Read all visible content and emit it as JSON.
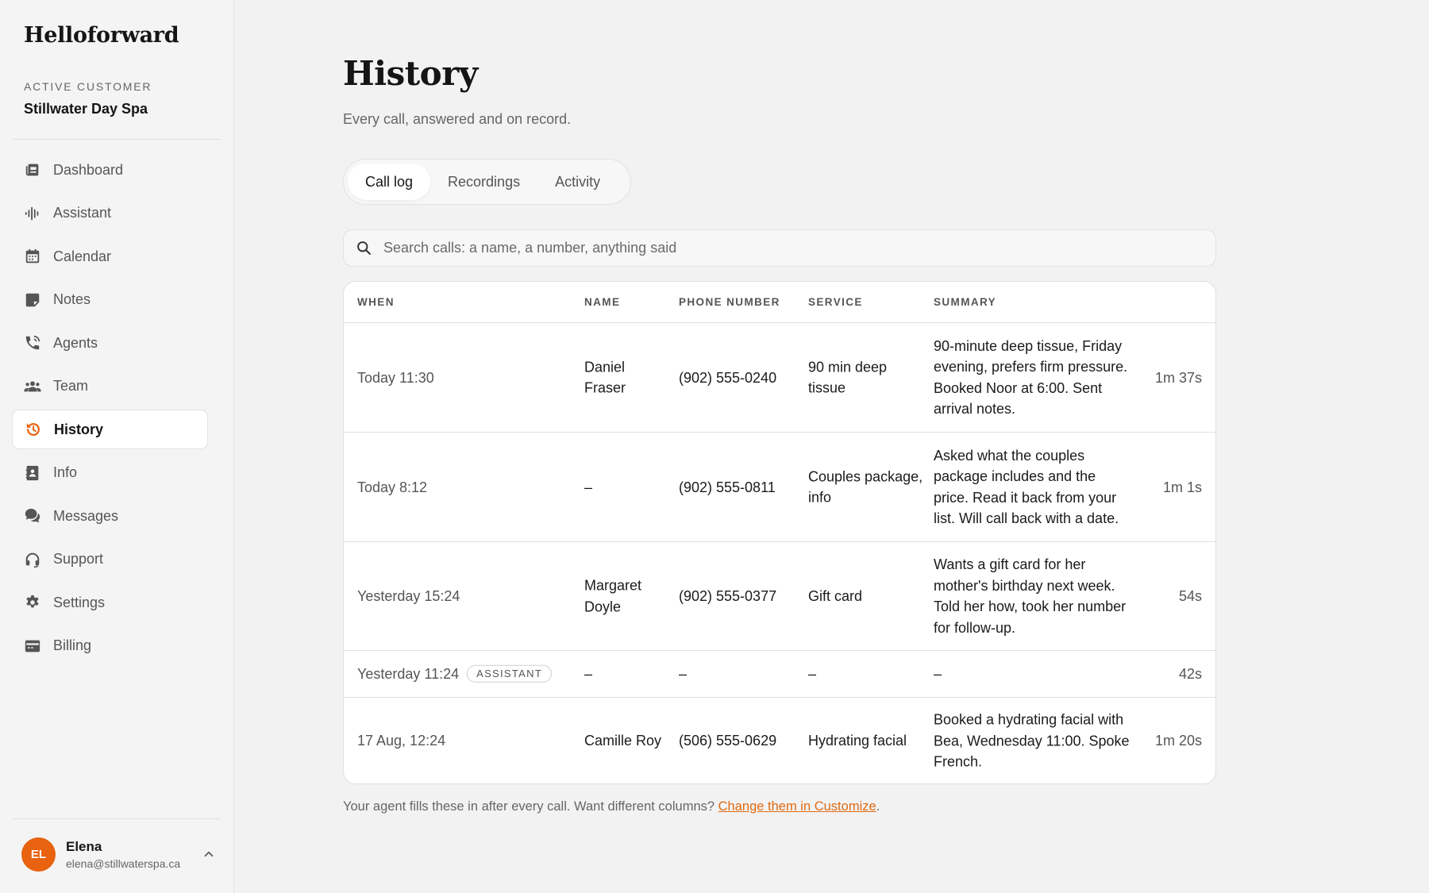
{
  "brand": "Helloforward",
  "customer": {
    "label": "ACTIVE CUSTOMER",
    "name": "Stillwater Day Spa"
  },
  "nav": [
    {
      "label": "Dashboard",
      "icon": "dashboard-icon"
    },
    {
      "label": "Assistant",
      "icon": "waveform-icon"
    },
    {
      "label": "Calendar",
      "icon": "calendar-icon"
    },
    {
      "label": "Notes",
      "icon": "note-icon"
    },
    {
      "label": "Agents",
      "icon": "phone-icon"
    },
    {
      "label": "Team",
      "icon": "users-icon"
    },
    {
      "label": "History",
      "icon": "history-icon",
      "active": true
    },
    {
      "label": "Info",
      "icon": "contact-card-icon"
    },
    {
      "label": "Messages",
      "icon": "chat-icon"
    },
    {
      "label": "Support",
      "icon": "headset-icon"
    },
    {
      "label": "Settings",
      "icon": "gear-icon"
    },
    {
      "label": "Billing",
      "icon": "credit-card-icon"
    }
  ],
  "user": {
    "initials": "EL",
    "name": "Elena",
    "email": "elena@stillwaterspa.ca"
  },
  "page": {
    "title": "History",
    "subtitle": "Every call, answered and on record."
  },
  "tabs": [
    {
      "label": "Call log",
      "active": true
    },
    {
      "label": "Recordings"
    },
    {
      "label": "Activity"
    }
  ],
  "search": {
    "placeholder": "Search calls: a name, a number, anything said",
    "value": ""
  },
  "table": {
    "headers": {
      "when": "WHEN",
      "name": "NAME",
      "phone": "PHONE NUMBER",
      "service": "SERVICE",
      "summary": "SUMMARY"
    },
    "rows": [
      {
        "when": "Today 11:30",
        "badge": "",
        "name": "Daniel Fraser",
        "phone": "(902) 555-0240",
        "service": "90 min deep tissue",
        "summary": "90-minute deep tissue, Friday evening, prefers firm pressure. Booked Noor at 6:00. Sent arrival notes.",
        "duration": "1m 37s"
      },
      {
        "when": "Today 8:12",
        "badge": "",
        "name": "–",
        "phone": "(902) 555-0811",
        "service": "Couples package, info",
        "summary": "Asked what the couples package includes and the price. Read it back from your list. Will call back with a date.",
        "duration": "1m 1s"
      },
      {
        "when": "Yesterday 15:24",
        "badge": "",
        "name": "Margaret Doyle",
        "phone": "(902) 555-0377",
        "service": "Gift card",
        "summary": "Wants a gift card for her mother's birthday next week. Told her how, took her number for follow-up.",
        "duration": "54s"
      },
      {
        "when": "Yesterday 11:24",
        "badge": "ASSISTANT",
        "name": "–",
        "phone": "–",
        "service": "–",
        "summary": "–",
        "duration": "42s"
      },
      {
        "when": "17 Aug, 12:24",
        "badge": "",
        "name": "Camille Roy",
        "phone": "(506) 555-0629",
        "service": "Hydrating facial",
        "summary": "Booked a hydrating facial with Bea, Wednesday 11:00. Spoke French.",
        "duration": "1m 20s"
      }
    ]
  },
  "footnote": {
    "text": "Your agent fills these in after every call. Want different columns? ",
    "link": "Change them in Customize",
    "end": "."
  },
  "colors": {
    "accent": "#e8620f",
    "link": "#e06a10",
    "background": "#f2f2f3"
  }
}
